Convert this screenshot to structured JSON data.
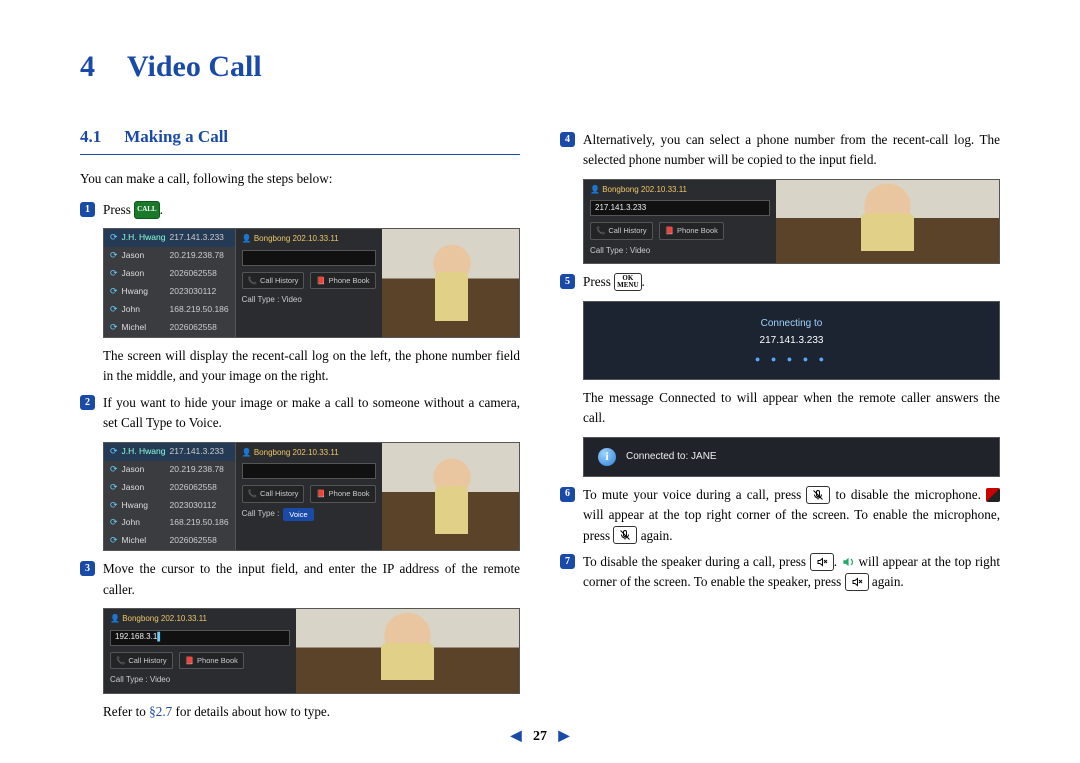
{
  "chapter": {
    "number": "4",
    "title": "Video Call"
  },
  "section": {
    "number": "4.1",
    "title": "Making a Call"
  },
  "intro": "You can make a call, following the steps below:",
  "steps": {
    "s1": {
      "num": "1",
      "text_a": "Press ",
      "text_b": "."
    },
    "s1_after": "The screen will display the recent-call log on the left, the phone number field in the middle, and your image on the right.",
    "s2": {
      "num": "2",
      "text": "If you want to hide your image or make a call to someone without a camera, set Call Type to Voice."
    },
    "s3": {
      "num": "3",
      "text": "Move the cursor to the input field, and enter the IP address of the remote caller."
    },
    "s3_after_a": "Refer to ",
    "s3_after_link": "§2.7",
    "s3_after_b": " for details about how to type.",
    "s4": {
      "num": "4",
      "text": "Alternatively, you can select a phone number from the recent-call log. The selected phone number will be copied to the input field."
    },
    "s5": {
      "num": "5",
      "text_a": "Press ",
      "text_b": "."
    },
    "s5_after": "The message Connected to will appear when the remote caller answers the call.",
    "s6": {
      "num": "6",
      "a": "To mute your voice during a call, press ",
      "b": " to disable the microphone. ",
      "c": " will appear at the top right corner of the screen. To enable the microphone, press ",
      "d": " again."
    },
    "s7": {
      "num": "7",
      "a": "To disable the speaker during a call, press ",
      "b": ". ",
      "c": " will appear at the top right corner of the screen. To enable the speaker, press ",
      "d": " again."
    }
  },
  "keys": {
    "call": "CALL",
    "ok_top": "OK",
    "ok_bot": "MENU"
  },
  "recent_log": {
    "header_name": "J.H. Hwang",
    "header_ip": "217.141.3.233",
    "rows": [
      {
        "name": "Jason",
        "ip": "20.219.238.78"
      },
      {
        "name": "Jason",
        "ip": "2026062558"
      },
      {
        "name": "Hwang",
        "ip": "2023030112"
      },
      {
        "name": "John",
        "ip": "168.219.50.186"
      },
      {
        "name": "Michel",
        "ip": "2026062558"
      }
    ]
  },
  "mid": {
    "user": "Bongbong  202.10.33.11",
    "btn_history": "Call History",
    "btn_phonebook": "Phone Book",
    "type_label": "Call Type : Video",
    "type_voice": "Voice",
    "input_ip": "192.168.3.1",
    "input_ip4": "217.141.3.233"
  },
  "connecting": {
    "label": "Connecting to",
    "ip": "217.141.3.233"
  },
  "connected": {
    "text": "Connected to: JANE"
  },
  "page_number": "27"
}
